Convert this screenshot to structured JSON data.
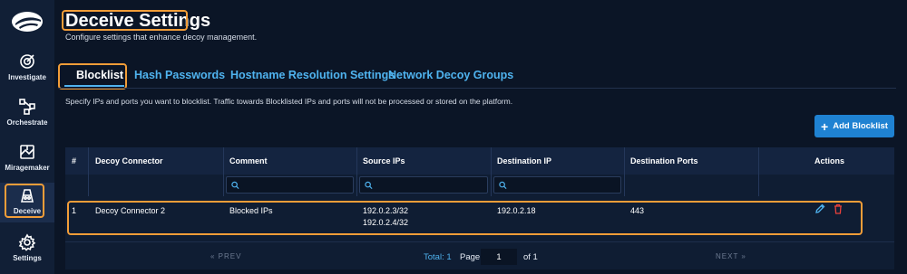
{
  "sidebar": {
    "items": [
      {
        "label": "Investigate",
        "icon": "investigate-icon"
      },
      {
        "label": "Orchestrate",
        "icon": "orchestrate-icon"
      },
      {
        "label": "Miragemaker",
        "icon": "miragemaker-icon"
      },
      {
        "label": "Deceive",
        "icon": "deceive-icon"
      },
      {
        "label": "Settings",
        "icon": "settings-icon"
      }
    ],
    "active": "Deceive"
  },
  "page": {
    "title": "Deceive Settings",
    "subtitle": "Configure settings that enhance decoy management."
  },
  "tabs": [
    {
      "label": "Blocklist"
    },
    {
      "label": "Hash Passwords"
    },
    {
      "label": "Hostname Resolution Settings"
    },
    {
      "label": "Network Decoy Groups"
    }
  ],
  "active_tab": "Blocklist",
  "description": "Specify IPs and ports you want to blocklist. Traffic towards Blocklisted IPs and ports will not be processed or stored on the platform.",
  "add_button_label": "Add Blocklist",
  "table": {
    "columns": [
      "#",
      "Decoy Connector",
      "Comment",
      "Source IPs",
      "Destination IP",
      "Destination Ports",
      "Actions"
    ],
    "rows": [
      {
        "index": "1",
        "connector": "Decoy Connector 2",
        "comment": "Blocked IPs",
        "source_ips": [
          "192.0.2.3/32",
          "192.0.2.4/32"
        ],
        "destination_ip": "192.0.2.18",
        "destination_ports": "443"
      }
    ]
  },
  "pagination": {
    "prev_label": "PREV",
    "next_label": "NEXT",
    "total_label": "Total: 1",
    "page_label": "Page",
    "page_value": "1",
    "of_label": "of 1"
  },
  "colors": {
    "accent": "#4fb3ef",
    "highlight": "#f29d38",
    "button": "#1f82d2",
    "delete": "#e8413b"
  }
}
